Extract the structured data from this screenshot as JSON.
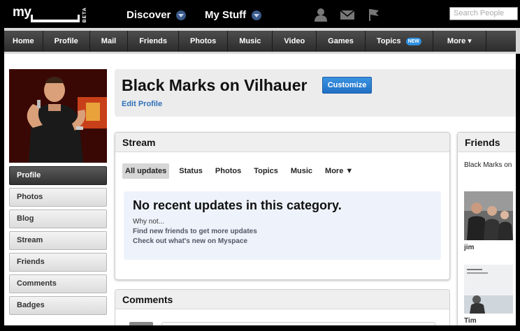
{
  "topbar": {
    "logo_text": "my",
    "beta": "BETA",
    "discover": "Discover",
    "my_stuff": "My Stuff",
    "search_placeholder": "Search People"
  },
  "nav": {
    "items": [
      "Home",
      "Profile",
      "Mail",
      "Friends",
      "Photos",
      "Music",
      "Video",
      "Games",
      "Topics",
      "More ▾"
    ],
    "new_badge": "NEW"
  },
  "sidebar": {
    "items": [
      "Profile",
      "Photos",
      "Blog",
      "Stream",
      "Friends",
      "Comments",
      "Badges"
    ],
    "active": "Profile"
  },
  "profile": {
    "title": "Black Marks on Vilhauer",
    "customize": "Customize",
    "edit": "Edit Profile"
  },
  "stream": {
    "heading": "Stream",
    "tabs": [
      "All updates",
      "Status",
      "Photos",
      "Topics",
      "Music",
      "More ▼"
    ],
    "active_tab": "All updates",
    "empty_title": "No recent updates in this category.",
    "why": "Why not...",
    "suggestion_1": "Find new friends to get more updates",
    "suggestion_2": "Check out what's new on Myspace"
  },
  "comments": {
    "heading": "Comments"
  },
  "friends": {
    "heading": "Friends",
    "subtitle": "Black Marks on",
    "list": [
      {
        "name": "jim"
      },
      {
        "name": "Tim"
      }
    ]
  },
  "colors": {
    "accent": "#1f6fc4",
    "link": "#2f6fb8",
    "nav_bg": "#3a3a3a",
    "empty_bg": "#eef3fb"
  }
}
